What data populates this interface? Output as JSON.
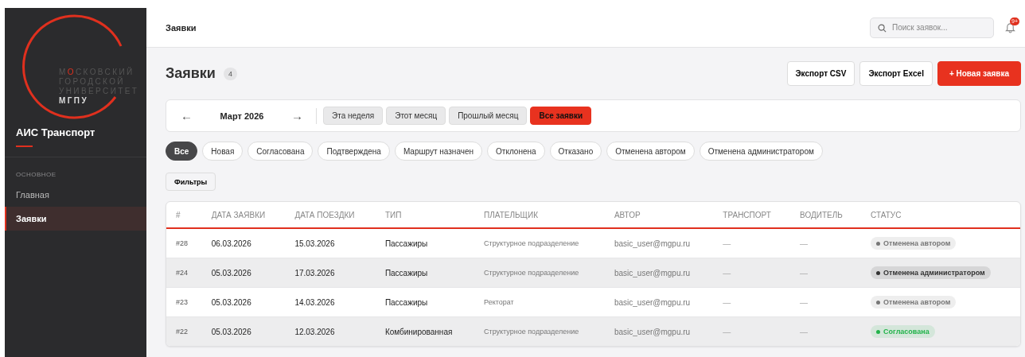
{
  "sidebar": {
    "logo": {
      "lines": [
        {
          "pre": "М",
          "accent": "О",
          "post": "СКОВСКИЙ"
        },
        {
          "pre": "ГОРОДСКОЙ"
        },
        {
          "pre": "УНИВЕРСИТЕТ"
        }
      ],
      "abbr": "МГПУ"
    },
    "app_title": "АИС Транспорт",
    "section": "ОСНОВНОЕ",
    "items": [
      {
        "label": "Главная",
        "selected": false
      },
      {
        "label": "Заявки",
        "selected": true
      }
    ]
  },
  "topbar": {
    "title": "Заявки",
    "search": {
      "placeholder": "Поиск заявок..."
    },
    "notifications": "9+"
  },
  "header": {
    "title": "Заявки",
    "count": "4",
    "buttons": [
      {
        "label": "Экспорт CSV",
        "kind": "plain"
      },
      {
        "label": "Экспорт Excel",
        "kind": "plain"
      },
      {
        "label": "+ Новая заявка",
        "kind": "primary"
      }
    ]
  },
  "period": {
    "prev": "←",
    "month": "Март 2026",
    "next": "→",
    "ranges": [
      {
        "label": "Эта неделя",
        "selected": false
      },
      {
        "label": "Этот месяц",
        "selected": false
      },
      {
        "label": "Прошлый месяц",
        "selected": false
      },
      {
        "label": "Все заявки",
        "selected": true
      }
    ]
  },
  "status_filters": [
    {
      "label": "Все",
      "selected": true
    },
    {
      "label": "Новая",
      "selected": false
    },
    {
      "label": "Согласована",
      "selected": false
    },
    {
      "label": "Подтверждена",
      "selected": false
    },
    {
      "label": "Маршрут назначен",
      "selected": false
    },
    {
      "label": "Отклонена",
      "selected": false
    },
    {
      "label": "Отказано",
      "selected": false
    },
    {
      "label": "Отменена автором",
      "selected": false
    },
    {
      "label": "Отменена администратором",
      "selected": false
    }
  ],
  "filters_button": "Фильтры",
  "table": {
    "columns": [
      "#",
      "ДАТА ЗАЯВКИ",
      "ДАТА ПОЕЗДКИ",
      "ТИП",
      "ПЛАТЕЛЬЩИК",
      "АВТОР",
      "ТРАНСПОРТ",
      "ВОДИТЕЛЬ",
      "СТАТУС"
    ],
    "rows": [
      {
        "id": "#28",
        "created": "06.03.2026",
        "trip": "15.03.2026",
        "type": "Пассажиры",
        "payer": "Структурное подразделение",
        "author": "basic_user@mgpu.ru",
        "transport": "—",
        "driver": "—",
        "status": "Отменена автором",
        "color": "#777777"
      },
      {
        "id": "#24",
        "created": "05.03.2026",
        "trip": "17.03.2026",
        "type": "Пассажиры",
        "payer": "Структурное подразделение",
        "author": "basic_user@mgpu.ru",
        "transport": "—",
        "driver": "—",
        "status": "Отменена администратором",
        "color": "#333333"
      },
      {
        "id": "#23",
        "created": "05.03.2026",
        "trip": "14.03.2026",
        "type": "Пассажиры",
        "payer": "Ректорат",
        "author": "basic_user@mgpu.ru",
        "transport": "—",
        "driver": "—",
        "status": "Отменена автором",
        "color": "#777777"
      },
      {
        "id": "#22",
        "created": "05.03.2026",
        "trip": "12.03.2026",
        "type": "Комбинированная",
        "payer": "Структурное подразделение",
        "author": "basic_user@mgpu.ru",
        "transport": "—",
        "driver": "—",
        "status": "Согласована",
        "color": "#22b34a"
      }
    ]
  }
}
